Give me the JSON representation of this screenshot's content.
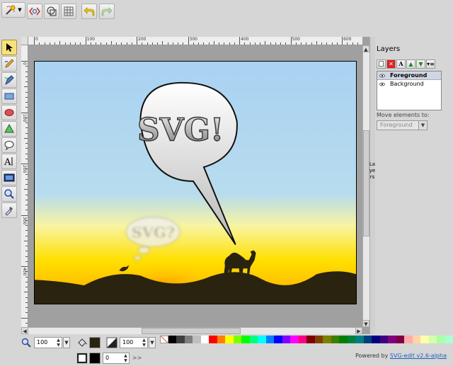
{
  "top_toolbar": {
    "tools": [
      {
        "name": "main-menu-button",
        "icon": "wizard-icon"
      },
      {
        "name": "source-button",
        "icon": "source-icon"
      },
      {
        "name": "wireframe-button",
        "icon": "wireframe-icon"
      },
      {
        "name": "grid-button",
        "icon": "grid-icon"
      },
      {
        "name": "undo-button",
        "icon": "undo-icon"
      },
      {
        "name": "redo-button",
        "icon": "redo-icon"
      }
    ]
  },
  "left_tools": [
    {
      "name": "select-tool",
      "icon": "pointer-icon"
    },
    {
      "name": "pencil-tool",
      "icon": "pencil-icon"
    },
    {
      "name": "pen-tool",
      "icon": "pen-icon"
    },
    {
      "name": "rect-tool",
      "icon": "rectangle-icon"
    },
    {
      "name": "ellipse-tool",
      "icon": "ellipse-icon"
    },
    {
      "name": "path-tool",
      "icon": "triangle-icon"
    },
    {
      "name": "shape-tool",
      "icon": "speech-icon"
    },
    {
      "name": "text-tool",
      "icon": "text-icon"
    },
    {
      "name": "image-tool",
      "icon": "image-icon"
    },
    {
      "name": "zoom-tool",
      "icon": "magnifier-icon"
    },
    {
      "name": "eyedropper-tool",
      "icon": "eyedropper-icon"
    }
  ],
  "rulers": {
    "top_labels": [
      "0",
      "100",
      "200",
      "300",
      "400",
      "500",
      "600"
    ],
    "left_labels": [
      "0",
      "100",
      "200",
      "300",
      "400"
    ]
  },
  "canvas": {
    "bubble_text": "SVG!",
    "thought_text": "SVG?"
  },
  "layers": {
    "title": "Layers",
    "handle_label": "Layers",
    "items": [
      {
        "label": "Foreground",
        "selected": true
      },
      {
        "label": "Background",
        "selected": false
      }
    ],
    "move_label": "Move elements to:",
    "move_value": "Foreground"
  },
  "bottom": {
    "zoom_value": "100",
    "opacity_value": "100",
    "stroke_width": "0",
    "more_label": ">>"
  },
  "powered": {
    "prefix": "Powered by",
    "link": "SVG-edit v2.6-alpha"
  },
  "colors": {
    "sky": "#a9d2f2",
    "sun": "#ffe000",
    "ground": "#2a2310",
    "accent_link": "#1f5fc1"
  }
}
